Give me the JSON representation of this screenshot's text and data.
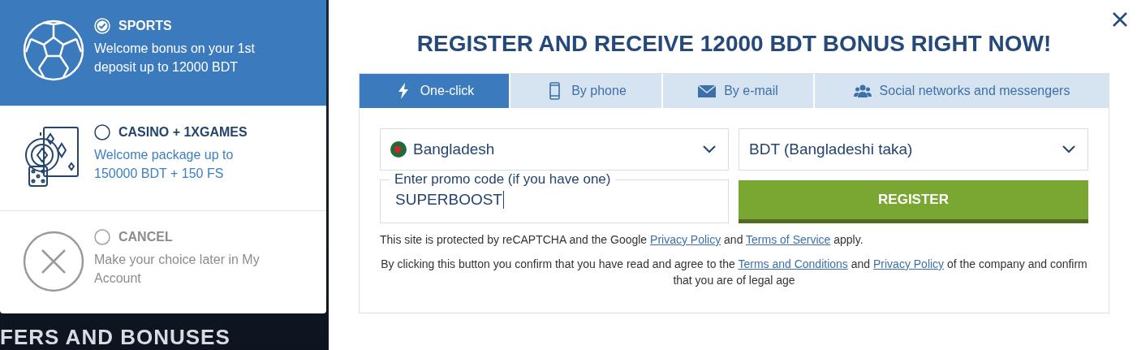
{
  "bonus_options": [
    {
      "kind": "sports",
      "title": "SPORTS",
      "description": "Welcome bonus on your 1st deposit up to 12000 BDT",
      "selected": true
    },
    {
      "kind": "casino",
      "title": "CASINO + 1XGAMES",
      "description": "Welcome package up to 150000 BDT + 150 FS",
      "selected": false
    },
    {
      "kind": "cancel",
      "title": "CANCEL",
      "description": "Make your choice later in My Account",
      "selected": false
    }
  ],
  "background_heading": "FERS AND BONUSES",
  "modal": {
    "title": "REGISTER AND RECEIVE 12000 BDT BONUS RIGHT NOW!",
    "tabs": [
      {
        "kind": "bolt",
        "label": "One-click",
        "selected": true
      },
      {
        "kind": "phone",
        "label": "By phone",
        "selected": false
      },
      {
        "kind": "mail",
        "label": "By e-mail",
        "selected": false
      },
      {
        "kind": "people",
        "label": "Social networks and messengers",
        "selected": false
      }
    ],
    "country_select": {
      "value": "Bangladesh"
    },
    "currency_select": {
      "value": "BDT (Bangladeshi taka)"
    },
    "promo_field": {
      "label": "Enter promo code (if you have one)",
      "value": "SUPERBOOST"
    },
    "register_button": "REGISTER",
    "recaptcha_note": [
      {
        "kind": "text",
        "text": "This site is protected by reCAPTCHA and the Google "
      },
      {
        "kind": "link",
        "text": "Privacy Policy"
      },
      {
        "kind": "text",
        "text": " and "
      },
      {
        "kind": "link",
        "text": "Terms of Service"
      },
      {
        "kind": "text",
        "text": " apply."
      }
    ],
    "consent_note": [
      {
        "kind": "text",
        "text": "By clicking this button you confirm that you have read and agree to the "
      },
      {
        "kind": "link",
        "text": "Terms and Conditions"
      },
      {
        "kind": "text",
        "text": " and "
      },
      {
        "kind": "link",
        "text": "Privacy Policy"
      },
      {
        "kind": "text",
        "text": " of the company and confirm that you are of legal age"
      }
    ]
  }
}
